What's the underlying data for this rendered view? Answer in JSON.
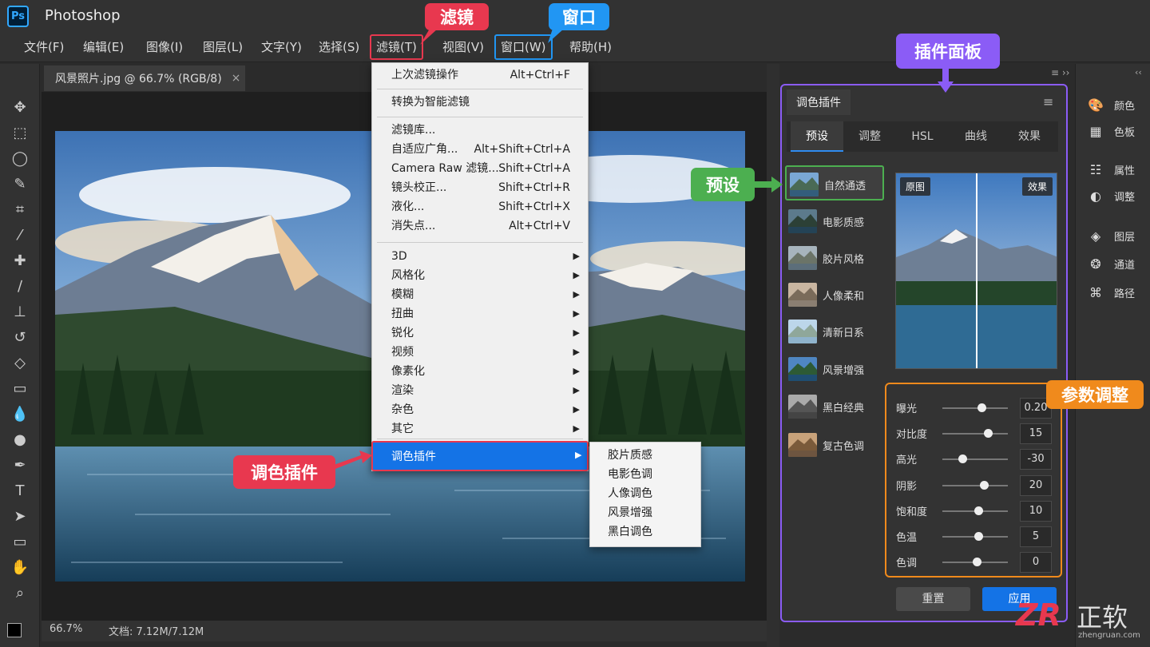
{
  "app": {
    "logo": "Ps",
    "title": "Photoshop"
  },
  "menubar": {
    "items": [
      "文件(F)",
      "编辑(E)",
      "图像(I)",
      "图层(L)",
      "文字(Y)",
      "选择(S)",
      "滤镜(T)",
      "视图(V)",
      "窗口(W)",
      "帮助(H)"
    ]
  },
  "callouts": {
    "filter": "滤镜",
    "window": "窗口",
    "plugin_panel": "插件面板",
    "preset": "预设",
    "params": "参数调整",
    "color_plugin": "调色插件"
  },
  "colors": {
    "filter_callout": "#e8384f",
    "window_callout": "#2196f3",
    "panel_callout": "#8b5cf6",
    "preset_callout": "#4caf50",
    "params_callout": "#f08a1c",
    "accent": "#1473e6"
  },
  "document": {
    "tab_title": "风景照片.jpg @ 66.7% (RGB/8)",
    "close": "×"
  },
  "statusbar": {
    "zoom": "66.7%",
    "doc_info": "文档: 7.12M/7.12M"
  },
  "filter_menu": {
    "last_filter": {
      "label": "上次滤镜操作",
      "shortcut": "Alt+Ctrl+F"
    },
    "smart_filter": {
      "label": "转换为智能滤镜"
    },
    "gallery": {
      "label": "滤镜库..."
    },
    "adaptive_wide": {
      "label": "自适应广角...",
      "shortcut": "Alt+Shift+Ctrl+A"
    },
    "camera_raw": {
      "label": "Camera Raw 滤镜...",
      "shortcut": "Shift+Ctrl+A"
    },
    "lens_correction": {
      "label": "镜头校正...",
      "shortcut": "Shift+Ctrl+R"
    },
    "liquify": {
      "label": "液化...",
      "shortcut": "Shift+Ctrl+X"
    },
    "vanishing_point": {
      "label": "消失点...",
      "shortcut": "Alt+Ctrl+V"
    },
    "groups": [
      "3D",
      "风格化",
      "模糊",
      "扭曲",
      "锐化",
      "视频",
      "像素化",
      "渲染",
      "杂色",
      "其它"
    ],
    "plugins": {
      "label": "调色插件"
    }
  },
  "submenu": {
    "items": [
      "胶片质感",
      "电影色调",
      "人像调色",
      "风景增强",
      "黑白调色"
    ]
  },
  "right_dock": {
    "items": [
      "颜色",
      "色板",
      "属性",
      "调整",
      "图层",
      "通道",
      "路径"
    ]
  },
  "plugin_panel": {
    "title": "调色插件",
    "tabs": [
      "预设",
      "调整",
      "HSL",
      "曲线",
      "效果"
    ],
    "presets": [
      "自然通透",
      "电影质感",
      "胶片风格",
      "人像柔和",
      "清新日系",
      "风景增强",
      "黑白经典",
      "复古色调"
    ],
    "preview": {
      "before": "原图",
      "after": "效果"
    },
    "params": [
      {
        "label": "曝光",
        "value": "0.20",
        "level": 0.6
      },
      {
        "label": "对比度",
        "value": "15",
        "level": 0.7
      },
      {
        "label": "高光",
        "value": "-30",
        "level": 0.3
      },
      {
        "label": "阴影",
        "value": "20",
        "level": 0.63
      },
      {
        "label": "饱和度",
        "value": "10",
        "level": 0.55
      },
      {
        "label": "色温",
        "value": "5",
        "level": 0.55
      },
      {
        "label": "色调",
        "value": "0",
        "level": 0.53
      }
    ],
    "buttons": {
      "reset": "重置",
      "apply": "应用"
    }
  },
  "watermark": {
    "logo": "ZR",
    "name": "正软",
    "url": "zhengruan.com"
  }
}
